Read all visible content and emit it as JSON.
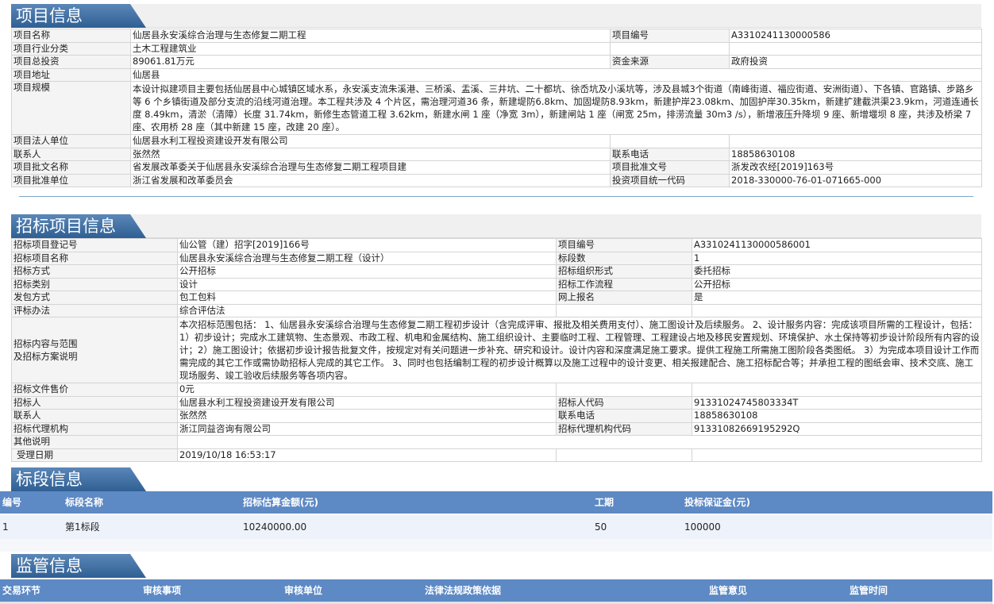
{
  "project": {
    "title": "项目信息",
    "rows": [
      [
        "项目名称",
        "仙居县永安溪综合治理与生态修复二期工程",
        "项目编号",
        "A3310241130000586"
      ],
      [
        "项目行业分类",
        "土木工程建筑业",
        "",
        ""
      ],
      [
        "项目总投资",
        "89061.81万元",
        "资金来源",
        "政府投资"
      ],
      [
        "项目地址",
        "仙居县",
        "",
        ""
      ]
    ],
    "scale_label": "项目规模",
    "scale_text": "本设计拟建项目主要包括仙居县中心城镇区域水系，永安溪支流朱溪港、三桥溪、盂溪、三井坑、二十都坑、徐岙坑及小溪坑等，涉及县城3个街道（南峰街道、福应街道、安洲街道）、下各镇、官路镇、步路乡等 6 个乡镇街道及部分支流的沿线河道治理。本工程共涉及 4 个片区，需治理河道36 条，新建堤防6.8km、加固堤防8.93km，新建护岸23.08km、加固护岸30.35km，新建扩建截洪渠23.9km，河道连通长度 8.49km，清淤（清障）长度 31.74km，新修生态管道工程 3.62km，新建水闸 1 座（净宽 3m），新建闸站 1 座（闸宽 25m，排涝流量 30m3 /s），新增液压升降坝 9 座、新增堰坝 8 座，共涉及桥梁 7 座、农用桥 28 座（其中新建 15 座，改建 20 座）。",
    "rows2": [
      [
        "项目法人单位",
        "仙居县水利工程投资建设开发有限公司",
        "",
        ""
      ],
      [
        "联系人",
        "张然然",
        "联系电话",
        "18858630108"
      ],
      [
        "项目批文名称",
        "省发展改革委关于仙居县永安溪综合治理与生态修复二期工程项目建",
        "项目批准文号",
        "浙发改农经[2019]163号"
      ],
      [
        "项目批准单位",
        "浙江省发展和改革委员会",
        "投资项目统一代码",
        "2018-330000-76-01-071665-000"
      ]
    ]
  },
  "tender": {
    "title": "招标项目信息",
    "rows": [
      [
        "招标项目登记号",
        "仙公管（建）招字[2019]166号",
        "项目编号",
        "A3310241130000586001"
      ],
      [
        "招标项目名称",
        "仙居县永安溪综合治理与生态修复二期工程（设计）",
        "标段数",
        "1"
      ],
      [
        "招标方式",
        "公开招标",
        "招标组织形式",
        "委托招标"
      ],
      [
        "招标类别",
        "设计",
        "招标工作流程",
        "公开招标"
      ],
      [
        "发包方式",
        "包工包料",
        "网上报名",
        "是"
      ],
      [
        "评标办法",
        "综合评估法",
        "",
        ""
      ]
    ],
    "scope_label_1": "招标内容与范围",
    "scope_label_2": "及招标方案说明",
    "scope_text": "本次招标范围包括： 1、仙居县永安溪综合治理与生态修复二期工程初步设计（含完成评审、报批及相关费用支付）、施工图设计及后续服务。 2、设计服务内容：完成该项目所需的工程设计，包括：1）初步设计；完成水工建筑物、生态景观、市政工程、机电和金属结构、施工组织设计、主要临时工程、工程管理、工程建设占地及移民安置规划、环境保护、水土保持等初步设计阶段所有内容的设计；2）施工图设计；依据初步设计报告批复文件，按规定对有关问题进一步补充、研究和设计。设计内容和深度满足施工要求。提供工程施工所需施工图阶段各类图纸。 3）为完成本项目设计工作而需完成的其它工作或需协助招标人完成的其它工作。 3、同时也包括编制工程的初步设计概算以及施工过程中的设计变更、相关报建配合、施工招标配合等；并承担工程的图纸会审、技术交底、施工现场服务、竣工验收后续服务等各项内容。",
    "rows2": [
      [
        "招标文件售价",
        "0元",
        "",
        ""
      ],
      [
        "招标人",
        "仙居县水利工程投资建设开发有限公司",
        "招标人代码",
        "91331024745803334T"
      ],
      [
        "联系人",
        "张然然",
        "联系电话",
        "18858630108"
      ],
      [
        "招标代理机构",
        "浙江同益咨询有限公司",
        "招标代理机构代码",
        "91331082669195292Q"
      ],
      [
        "其他说明",
        "",
        "",
        ""
      ],
      [
        "受理日期",
        "2019/10/18 16:53:17",
        "",
        ""
      ]
    ]
  },
  "section": {
    "title": "标段信息",
    "headers": [
      "编号",
      "标段名称",
      "招标估算金额(元)",
      "工期",
      "投标保证金(元)"
    ],
    "row": [
      "1",
      "第1标段",
      "10240000.00",
      "50",
      "100000"
    ]
  },
  "supervision": {
    "title": "监管信息",
    "headers": [
      "交易环节",
      "审核事项",
      "审核单位",
      "法律法规政策依据",
      "监管意见",
      "监管时间"
    ]
  }
}
